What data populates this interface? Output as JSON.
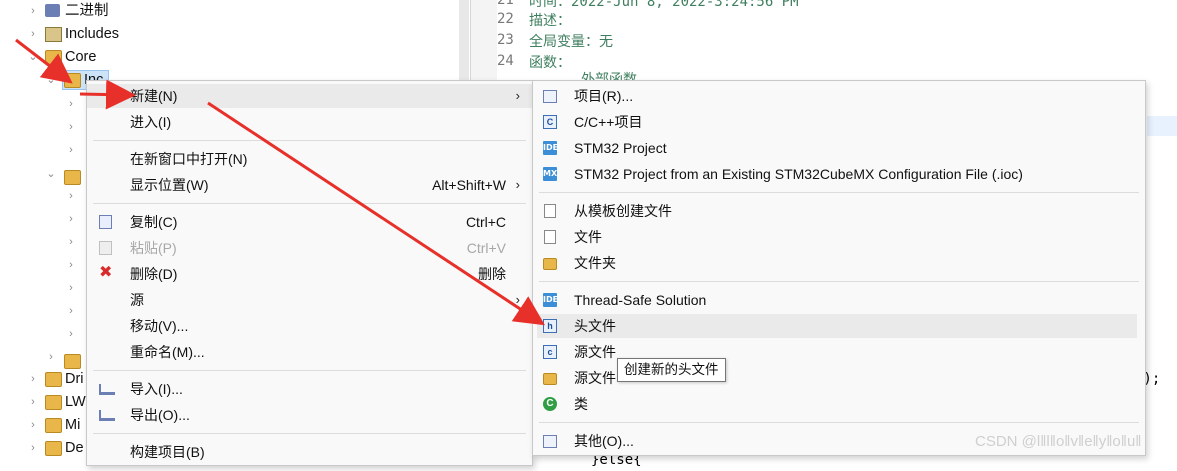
{
  "tree": {
    "items": [
      {
        "label": "二进制",
        "expanded": false
      },
      {
        "label": "Includes",
        "expanded": false
      },
      {
        "label": "Core",
        "expanded": true
      },
      {
        "label": "Inc",
        "expanded": true
      },
      {
        "label": "Dri",
        "expanded": false
      },
      {
        "label": "LW",
        "expanded": false
      },
      {
        "label": "Mi",
        "expanded": false
      },
      {
        "label": "De",
        "expanded": false
      }
    ]
  },
  "editor": {
    "lines": [
      {
        "num": "21",
        "text": "时间：2022-Jun 8, 2022-3:24:56 PM"
      },
      {
        "num": "22",
        "text": "描述："
      },
      {
        "num": "23",
        "text": "全局变量：无"
      },
      {
        "num": "24",
        "text": "函数："
      },
      {
        "num": "",
        "text": "外部函数"
      }
    ],
    "fragment_right": "));",
    "fragment_bottom": "}else{"
  },
  "context_menu": {
    "items": [
      {
        "label": "新建(N)",
        "shortcut": "",
        "submenu": true
      },
      {
        "label": "进入(I)",
        "shortcut": ""
      },
      {
        "label": "在新窗口中打开(N)",
        "shortcut": ""
      },
      {
        "label": "显示位置(W)",
        "shortcut": "Alt+Shift+W",
        "submenu": true
      },
      {
        "label": "复制(C)",
        "shortcut": "Ctrl+C",
        "icon": "copy-icon"
      },
      {
        "label": "粘贴(P)",
        "shortcut": "Ctrl+V",
        "icon": "paste-icon",
        "disabled": true
      },
      {
        "label": "删除(D)",
        "shortcut": "删除",
        "icon": "delete-icon"
      },
      {
        "label": "源",
        "shortcut": "",
        "submenu": true
      },
      {
        "label": "移动(V)...",
        "shortcut": ""
      },
      {
        "label": "重命名(M)...",
        "shortcut": ""
      },
      {
        "label": "导入(I)...",
        "shortcut": "",
        "icon": "import-icon"
      },
      {
        "label": "导出(O)...",
        "shortcut": "",
        "icon": "export-icon"
      },
      {
        "label": "构建项目(B)",
        "shortcut": ""
      }
    ]
  },
  "submenu": {
    "items": [
      {
        "label": "项目(R)...",
        "icon": "new-project-icon"
      },
      {
        "label": "C/C++项目",
        "icon": "cpp-project-icon"
      },
      {
        "label": "STM32 Project",
        "icon": "ide-icon"
      },
      {
        "label": "STM32 Project from an Existing STM32CubeMX Configuration File (.ioc)",
        "icon": "mx-icon"
      },
      {
        "label": "从模板创建文件",
        "icon": "template-file-icon"
      },
      {
        "label": "文件",
        "icon": "file-icon"
      },
      {
        "label": "文件夹",
        "icon": "folder-icon"
      },
      {
        "label": "Thread-Safe Solution",
        "icon": "ide-icon"
      },
      {
        "label": "头文件",
        "icon": "header-file-icon"
      },
      {
        "label": "源文件",
        "icon": "source-file-icon"
      },
      {
        "label": "源文件",
        "icon": "source-folder-icon"
      },
      {
        "label": "类",
        "icon": "class-icon"
      },
      {
        "label": "其他(O)...",
        "icon": "other-icon"
      }
    ],
    "ide_badge": "IDE",
    "mx_badge": "MX"
  },
  "tooltip": "创建新的头文件",
  "watermark": "CSDN @l‖l‖o‖v‖e‖y‖o‖u‖",
  "colors": {
    "arrow": "#e8302a",
    "menu_bg": "#f9f9f9",
    "hover": "#eaeaea"
  }
}
